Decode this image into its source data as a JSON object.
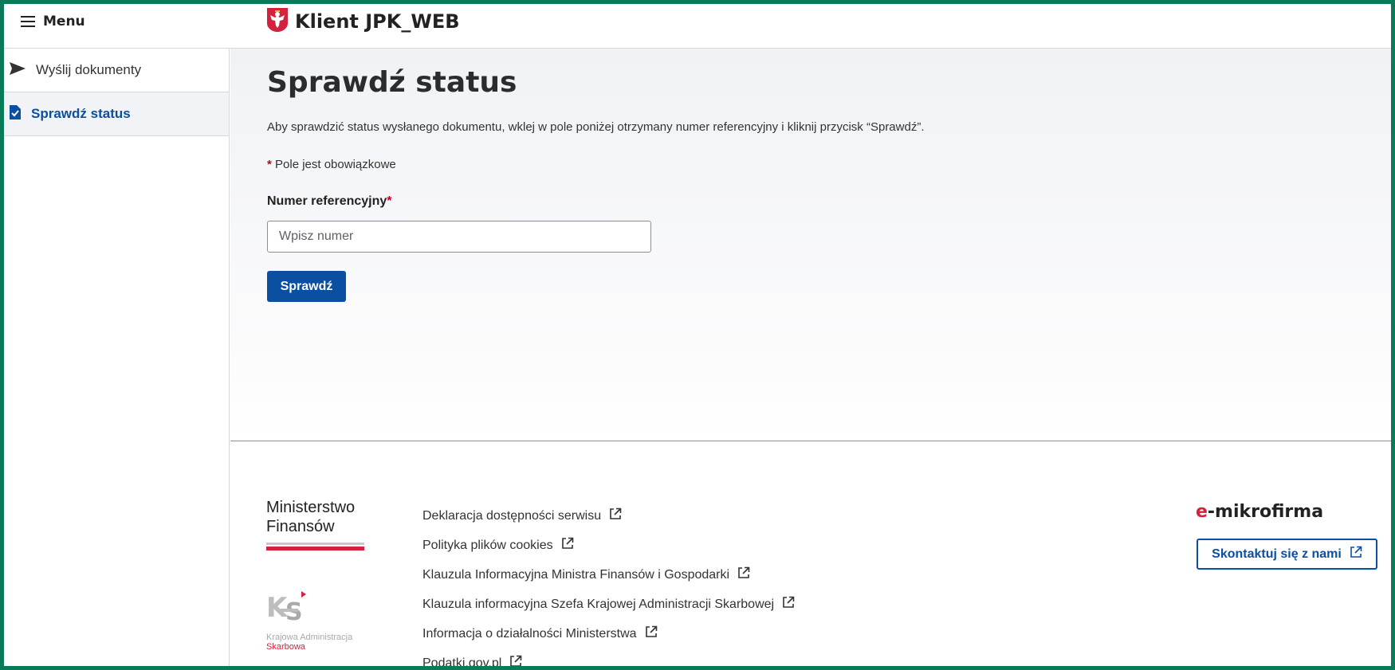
{
  "header": {
    "menu_label": "Menu",
    "app_title": "Klient JPK_WEB",
    "menu_icon": "hamburger-icon",
    "logo_icon": "polish-eagle-emblem"
  },
  "sidebar": {
    "items": [
      {
        "label": "Wyślij dokumenty",
        "icon": "send-icon",
        "active": false
      },
      {
        "label": "Sprawdź status",
        "icon": "document-check-icon",
        "active": true
      }
    ]
  },
  "main": {
    "title": "Sprawdź status",
    "intro": "Aby sprawdzić status wysłanego dokumentu, wklej w pole poniżej otrzymany numer referencyjny i kliknij przycisk “Sprawdź”.",
    "required_star": "*",
    "required_note": "Pole jest obowiązkowe",
    "field_label": "Numer referencyjny",
    "field_placeholder": "Wpisz numer",
    "field_value": "",
    "submit_label": "Sprawdź"
  },
  "footer": {
    "ministry_line1": "Ministerstwo",
    "ministry_line2": "Finansów",
    "kas_line1": "Krajowa Administracja",
    "kas_line2": "Skarbowa",
    "links": [
      "Deklaracja dostępności serwisu",
      "Polityka plików cookies",
      "Klauzula Informacyjna Ministra Finansów i Gospodarki",
      "Klauzula informacyjna Szefa Krajowej Administracji Skarbowej",
      "Informacja o działalności Ministerstwa",
      "Podatki.gov.pl"
    ],
    "emikro_e": "e",
    "emikro_rest": "-mikrofirma",
    "contact_label": "Skontaktuj się z nami"
  },
  "colors": {
    "primary": "#0b4fa0",
    "accent_red": "#d4213d",
    "frame": "#0a7a5a"
  }
}
